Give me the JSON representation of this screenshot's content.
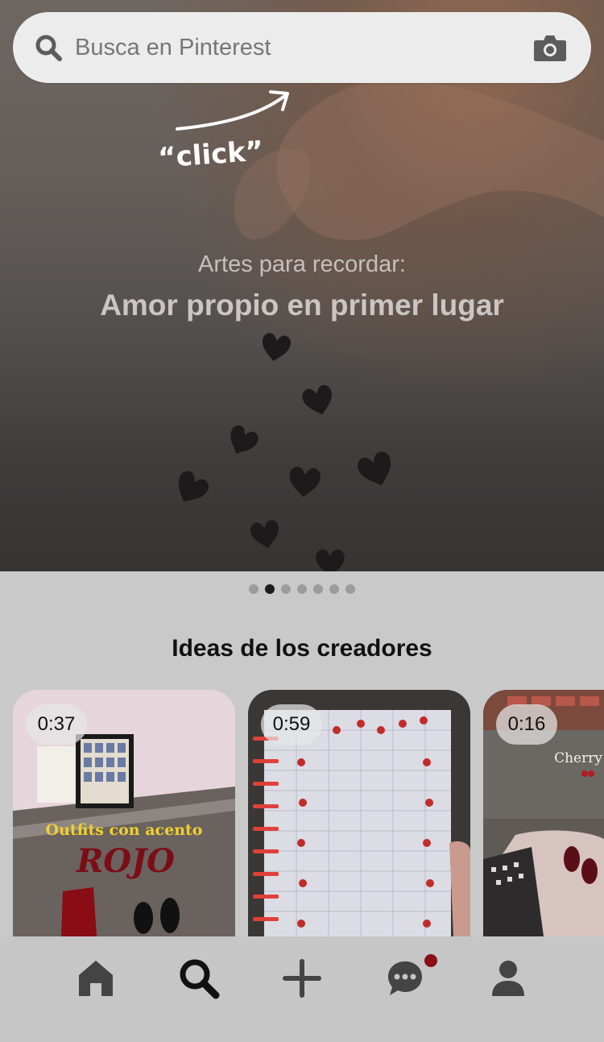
{
  "search": {
    "placeholder": "Busca en Pinterest",
    "search_icon": "search-icon",
    "camera_icon": "camera-icon"
  },
  "hero": {
    "handwriting": "“click”",
    "subtitle": "Artes para recordar:",
    "title": "Amor propio en primer lugar",
    "carousel_total": 7,
    "carousel_active": 2
  },
  "section": {
    "title": "Ideas de los creadores"
  },
  "cards": [
    {
      "duration": "0:37",
      "overlay_line1": "Outfits con acento",
      "overlay_line2": "ROJO"
    },
    {
      "duration": "0:59"
    },
    {
      "duration": "0:16",
      "overlay_line1": "Cherry"
    }
  ],
  "tabbar": {
    "items": [
      {
        "name": "home",
        "icon": "home-icon"
      },
      {
        "name": "search",
        "icon": "search-icon",
        "active": true
      },
      {
        "name": "create",
        "icon": "plus-icon"
      },
      {
        "name": "messages",
        "icon": "chat-icon",
        "has_badge": true
      },
      {
        "name": "profile",
        "icon": "person-icon"
      }
    ]
  },
  "colors": {
    "badge": "#8b0d16",
    "search_bar": "#ececec",
    "tabbar": "#c6c6c6"
  }
}
